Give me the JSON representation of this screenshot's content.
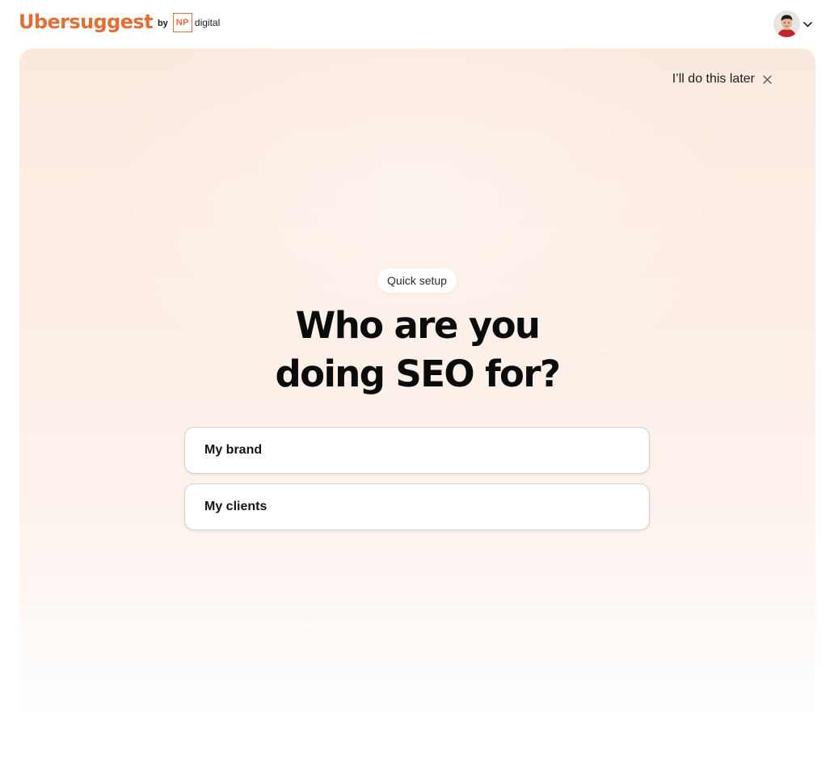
{
  "brand": {
    "name": "Ubersuggest",
    "by": "by",
    "np": "NP",
    "digital": "digital",
    "accent_color": "#e36d34"
  },
  "header": {
    "avatar_icon": "user-avatar",
    "menu_icon": "chevron-down-icon"
  },
  "dismiss": {
    "label": "I’ll do this later",
    "icon": "close-icon"
  },
  "setup": {
    "badge": "Quick setup",
    "headline_line1": "Who are you",
    "headline_line2": "doing SEO for?",
    "options": [
      {
        "label": "My brand"
      },
      {
        "label": "My clients"
      }
    ]
  }
}
